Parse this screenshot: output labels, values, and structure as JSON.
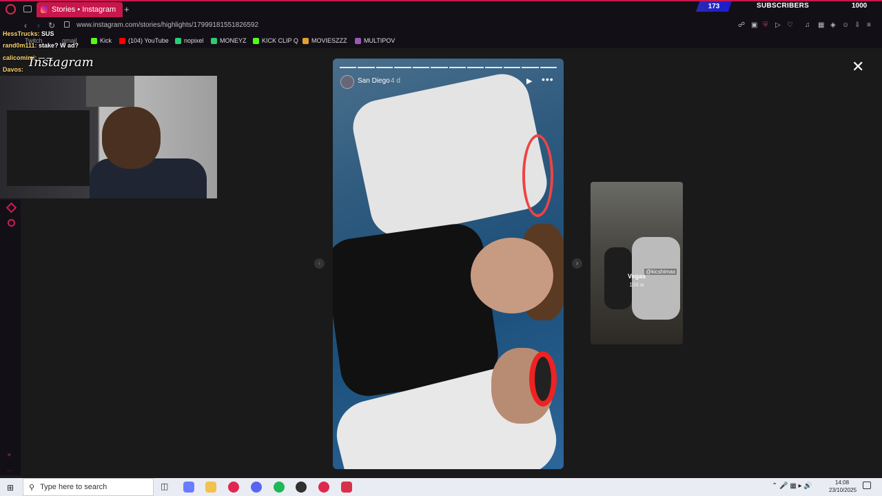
{
  "browser": {
    "tab_title": "Stories • Instagram",
    "new_tab": "+",
    "url": "www.instagram.com/stories/highlights/17999181551826592",
    "bookmarks": [
      {
        "label": "Kick",
        "color": "#53fc18"
      },
      {
        "label": "(104) YouTube",
        "color": "#ff0000"
      },
      {
        "label": "nopixel",
        "color": "#2ecc71"
      },
      {
        "label": "MONEYZ",
        "color": "#2ecc71"
      },
      {
        "label": "KICK CLIP Q",
        "color": "#53fc18"
      },
      {
        "label": "MOVIESZZZ",
        "color": "#e0a030"
      },
      {
        "label": "MULTIPOV",
        "color": "#9b59b6"
      }
    ],
    "hidden_bookmarks": [
      "Twitch",
      "gmail"
    ]
  },
  "stream_overlay": {
    "sub_left": "173",
    "sub_label": "SUBSCRIBERS",
    "sub_right": "1000",
    "chat": [
      {
        "name": "HessTrucks:",
        "text": "SUS"
      },
      {
        "name": "rand0m111:",
        "text": "stake? W ad?"
      },
      {
        "name": "calicomimi:",
        "text": "— —"
      },
      {
        "name": "Davos:",
        "text": ""
      }
    ],
    "watermark": "Instagram"
  },
  "story": {
    "title": "San Diego",
    "time": "4 d",
    "segments": 12
  },
  "next_story": {
    "title": "Vegas",
    "sub": "104 w",
    "tag": "@kicshimax"
  },
  "taskbar": {
    "search_placeholder": "Type here to search",
    "time": "14:08",
    "date": "23/10/2025",
    "apps": [
      {
        "name": "copilot",
        "color": "#6a7cff"
      },
      {
        "name": "explorer",
        "color": "#f2c14e"
      },
      {
        "name": "opera",
        "color": "#e0284f"
      },
      {
        "name": "discord",
        "color": "#5865f2"
      },
      {
        "name": "spotify",
        "color": "#1db954"
      },
      {
        "name": "obs",
        "color": "#303030"
      },
      {
        "name": "app-red",
        "color": "#e0284f"
      },
      {
        "name": "app-red-2",
        "color": "#d9304a"
      }
    ]
  }
}
